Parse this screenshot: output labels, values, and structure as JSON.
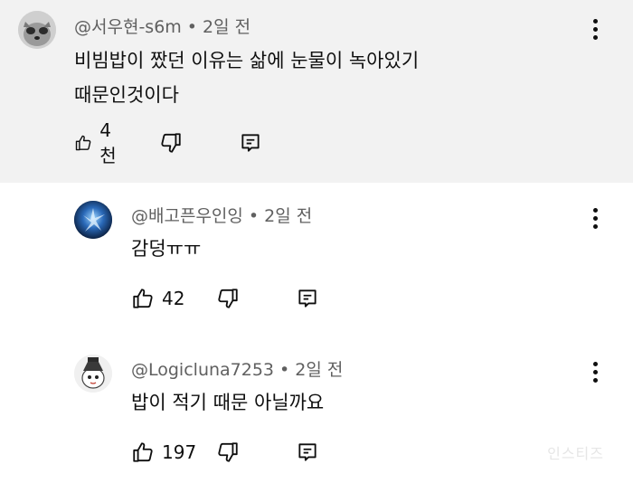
{
  "comments": [
    {
      "author": "@서우현-s6m",
      "time": "2일 전",
      "text_lines": [
        "비빔밥이 짰던 이유는 삶에 눈물이 녹아있기",
        "때문인것이다"
      ],
      "likes": "4천"
    },
    {
      "author": "@배고픈우인잉",
      "time": "2일 전",
      "text_lines": [
        "감덩ㅠㅠ"
      ],
      "likes": "42"
    },
    {
      "author": "@Logicluna7253",
      "time": "2일 전",
      "text_lines": [
        "밥이 적기 때문 아닐까요"
      ],
      "likes": "197"
    }
  ],
  "separator": "•",
  "icons": {
    "like": "thumbs-up-icon",
    "dislike": "thumbs-down-icon",
    "reply": "reply-icon",
    "menu": "more-vert-icon"
  },
  "colors": {
    "highlight_bg": "#f2f2f2",
    "meta_text": "#606060",
    "text": "#0f0f0f"
  },
  "watermark": "인스티즈"
}
